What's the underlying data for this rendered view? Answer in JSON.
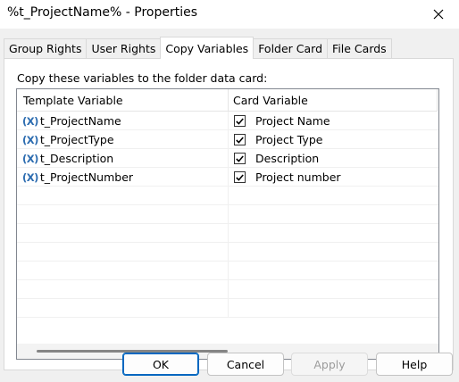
{
  "window": {
    "title": "%t_ProjectName% - Properties"
  },
  "tabs": [
    {
      "label": "Group Rights",
      "active": false
    },
    {
      "label": "User Rights",
      "active": false
    },
    {
      "label": "Copy Variables",
      "active": true
    },
    {
      "label": "Folder Card",
      "active": false
    },
    {
      "label": "File Cards",
      "active": false
    }
  ],
  "panel": {
    "label": "Copy these variables to the folder data card:",
    "columns": {
      "template": "Template Variable",
      "card": "Card Variable"
    },
    "rows": [
      {
        "icon": "(X)",
        "template": "t_ProjectName",
        "checked": true,
        "card": "Project Name"
      },
      {
        "icon": "(X)",
        "template": "t_ProjectType",
        "checked": true,
        "card": "Project Type"
      },
      {
        "icon": "(X)",
        "template": "t_Description",
        "checked": true,
        "card": "Description"
      },
      {
        "icon": "(X)",
        "template": "t_ProjectNumber",
        "checked": true,
        "card": "Project number"
      }
    ]
  },
  "buttons": {
    "ok": "OK",
    "cancel": "Cancel",
    "apply": "Apply",
    "help": "Help"
  },
  "colors": {
    "accent": "#0067c0",
    "variable_icon": "#2c6cb0"
  }
}
